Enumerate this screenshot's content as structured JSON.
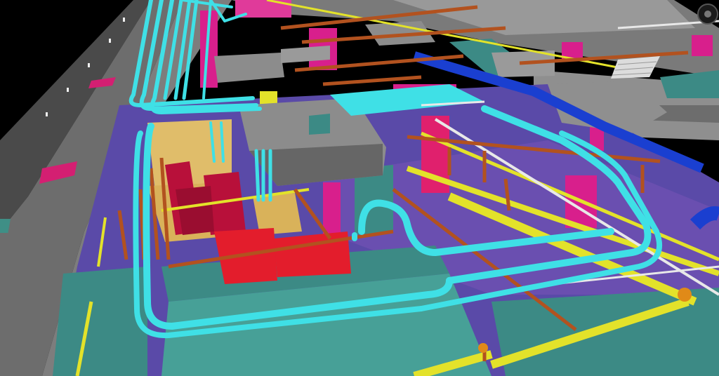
{
  "scene": {
    "kind": "bim-mep-model-render",
    "palette": {
      "sky": "#000000",
      "slab_gray": "#8a8a8a",
      "slab_dark": "#5f5f5f",
      "floor_purple": "#5a4aa8",
      "wall_teal": "#3c8a85",
      "duct_magenta": "#d81f8c",
      "pipe_cyan": "#3fe0e6",
      "pipe_copper": "#b2521f",
      "pipe_yellow": "#e3e22a",
      "pipe_blue": "#1a3fd0",
      "tray_tan": "#e0bd6a",
      "equipment_red": "#e31d2c",
      "pipe_white": "#e8e8e8"
    },
    "corner_icon": "orbit-gizmo-icon"
  }
}
